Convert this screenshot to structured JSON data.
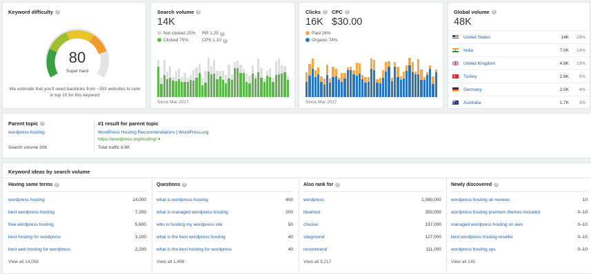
{
  "keyword_difficulty": {
    "title": "Keyword difficulty",
    "score": "80",
    "score_label": "Super hard",
    "score_fraction": 0.8,
    "note": "We estimate that you'll need backlinks from ~353 websites to rank in top 10 for this keyword"
  },
  "search_volume": {
    "title": "Search volume",
    "value": "14K",
    "not_clicked": "Not clicked 25%",
    "clicked": "Clicked 75%",
    "rr": "RR 1.25",
    "cps": "CPS 1.10",
    "since": "Since Mar 2017",
    "colors": {
      "clicked": "#5cb84a",
      "not_clicked": "#dedede"
    }
  },
  "clicks": {
    "title": "Clicks",
    "value": "16K",
    "cpc_title": "CPC",
    "cpc_value": "$30.00",
    "paid": "Paid 26%",
    "organic": "Organic 74%",
    "since": "Since Mar 2017",
    "colors": {
      "paid": "#f5a84a",
      "organic": "#2b75c0"
    }
  },
  "global_volume": {
    "title": "Global volume",
    "value": "48K",
    "countries": [
      {
        "name": "United States",
        "value": "14K",
        "pct": "29%",
        "flag": "us"
      },
      {
        "name": "India",
        "value": "7.0K",
        "pct": "14%",
        "flag": "in"
      },
      {
        "name": "United Kingdom",
        "value": "4.9K",
        "pct": "10%",
        "flag": "uk"
      },
      {
        "name": "Turkey",
        "value": "2.6K",
        "pct": "5%",
        "flag": "tr"
      },
      {
        "name": "Germany",
        "value": "2.0K",
        "pct": "4%",
        "flag": "de"
      },
      {
        "name": "Australia",
        "value": "1.7K",
        "pct": "3%",
        "flag": "au"
      }
    ]
  },
  "parent_topic": {
    "title": "Parent topic",
    "link": "wordpress hosting",
    "search_volume": "Search volume 20K",
    "result_title": "#1 result for parent topic",
    "result_link": "WordPress Hosting Recommendations | WordPress.org",
    "result_url": "https://wordpress.org/hosting/ ▾",
    "total_traffic": "Total traffic 8.6K"
  },
  "ideas": {
    "title": "Keyword ideas by search volume",
    "columns": [
      {
        "title": "Having same terms",
        "rows": [
          {
            "kw": "wordpress hosting",
            "v": "14,000"
          },
          {
            "kw": "best wordpress hosting",
            "v": "7,200"
          },
          {
            "kw": "free wordpress hosting",
            "v": "5,600"
          },
          {
            "kw": "best hosting for wordpress",
            "v": "3,100"
          },
          {
            "kw": "best web hosting for wordpress",
            "v": "2,200"
          }
        ],
        "view_all": "View all 14,056"
      },
      {
        "title": "Questions",
        "rows": [
          {
            "kw": "what is wordpress hosting",
            "v": "400"
          },
          {
            "kw": "what is managed wordpress hosting",
            "v": "200"
          },
          {
            "kw": "who is hosting my wordpress site",
            "v": "50"
          },
          {
            "kw": "what is the best wordpress hosting",
            "v": "40"
          },
          {
            "kw": "what is the best hosting for wordpress",
            "v": "40"
          }
        ],
        "view_all": "View all 1,498"
      },
      {
        "title": "Also rank for",
        "rows": [
          {
            "kw": "wordpress",
            "v": "1,080,000"
          },
          {
            "kw": "bluehost",
            "v": "350,000"
          },
          {
            "kw": "choose",
            "v": "137,000"
          },
          {
            "kw": "siteground",
            "v": "127,000"
          },
          {
            "kw": "recommend",
            "v": "111,000"
          }
        ],
        "view_all": "View all 9,217"
      },
      {
        "title": "Newly discovered",
        "rows": [
          {
            "kw": "wordpress hosting uk reviews",
            "v": "10"
          },
          {
            "kw": "wordpress hosting premium themes included",
            "v": "0–10"
          },
          {
            "kw": "managed wordpress hosting on aws",
            "v": "0–10"
          },
          {
            "kw": "best wordpress hosting reseller",
            "v": "0–10"
          },
          {
            "kw": "wordpress hosting vps",
            "v": "0–10"
          }
        ],
        "view_all": "View all 145"
      }
    ]
  }
}
